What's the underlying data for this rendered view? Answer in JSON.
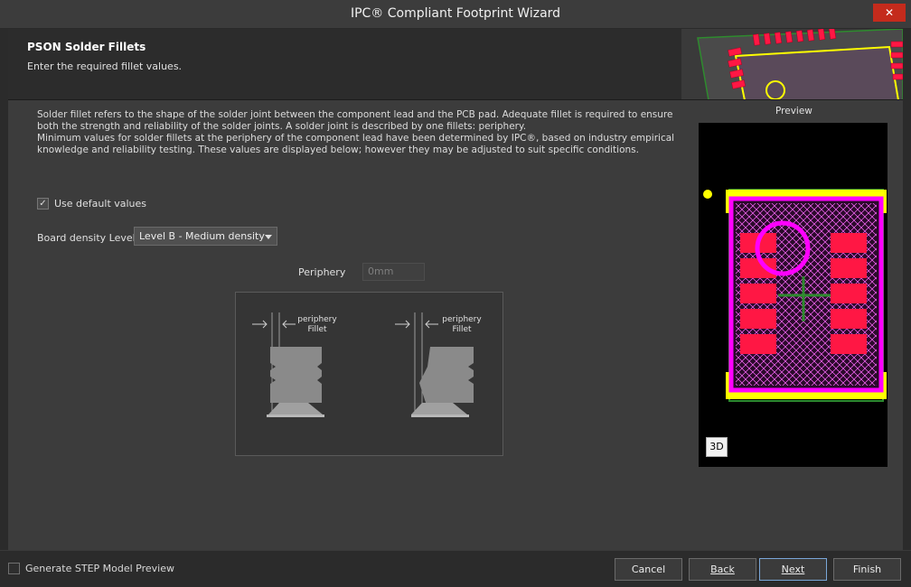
{
  "window": {
    "title": "IPC® Compliant Footprint Wizard",
    "close_glyph": "✕"
  },
  "header": {
    "title": "PSON Solder Fillets",
    "subtitle": "Enter the required fillet values."
  },
  "description": {
    "line1": "Solder fillet refers to the shape of the solder joint between the component lead and the PCB pad. Adequate fillet is required to ensure both the strength and reliability of the solder joints. A solder joint is described by one fillets: periphery.",
    "line2": "Minimum values for solder fillets at the periphery of the component lead have been determined by IPC®, based on industry empirical knowledge and reliability testing. These values are displayed below; however they may be adjusted to suit specific conditions."
  },
  "defaults": {
    "label": "Use default values",
    "checked": true,
    "check_glyph": "✓"
  },
  "density": {
    "label": "Board density Level",
    "value": "Level B - Medium density"
  },
  "periphery": {
    "label": "Periphery",
    "value": "0mm"
  },
  "diagram": {
    "left_label_1": "periphery",
    "left_label_2": "Fillet",
    "right_label_1": "periphery",
    "right_label_2": "Fillet"
  },
  "preview": {
    "label": "Preview",
    "view_toggle": "3D"
  },
  "footer": {
    "step_preview_label": "Generate STEP Model Preview",
    "cancel": "Cancel",
    "back_label": "Back",
    "next_label": "Next",
    "finish": "Finish"
  },
  "colors": {
    "pad": "#ff1744",
    "courtyard": "#ff00ff",
    "silkscreen": "#ffff00",
    "assembly": "#2e8b2e",
    "accent": "#c42b1c"
  }
}
